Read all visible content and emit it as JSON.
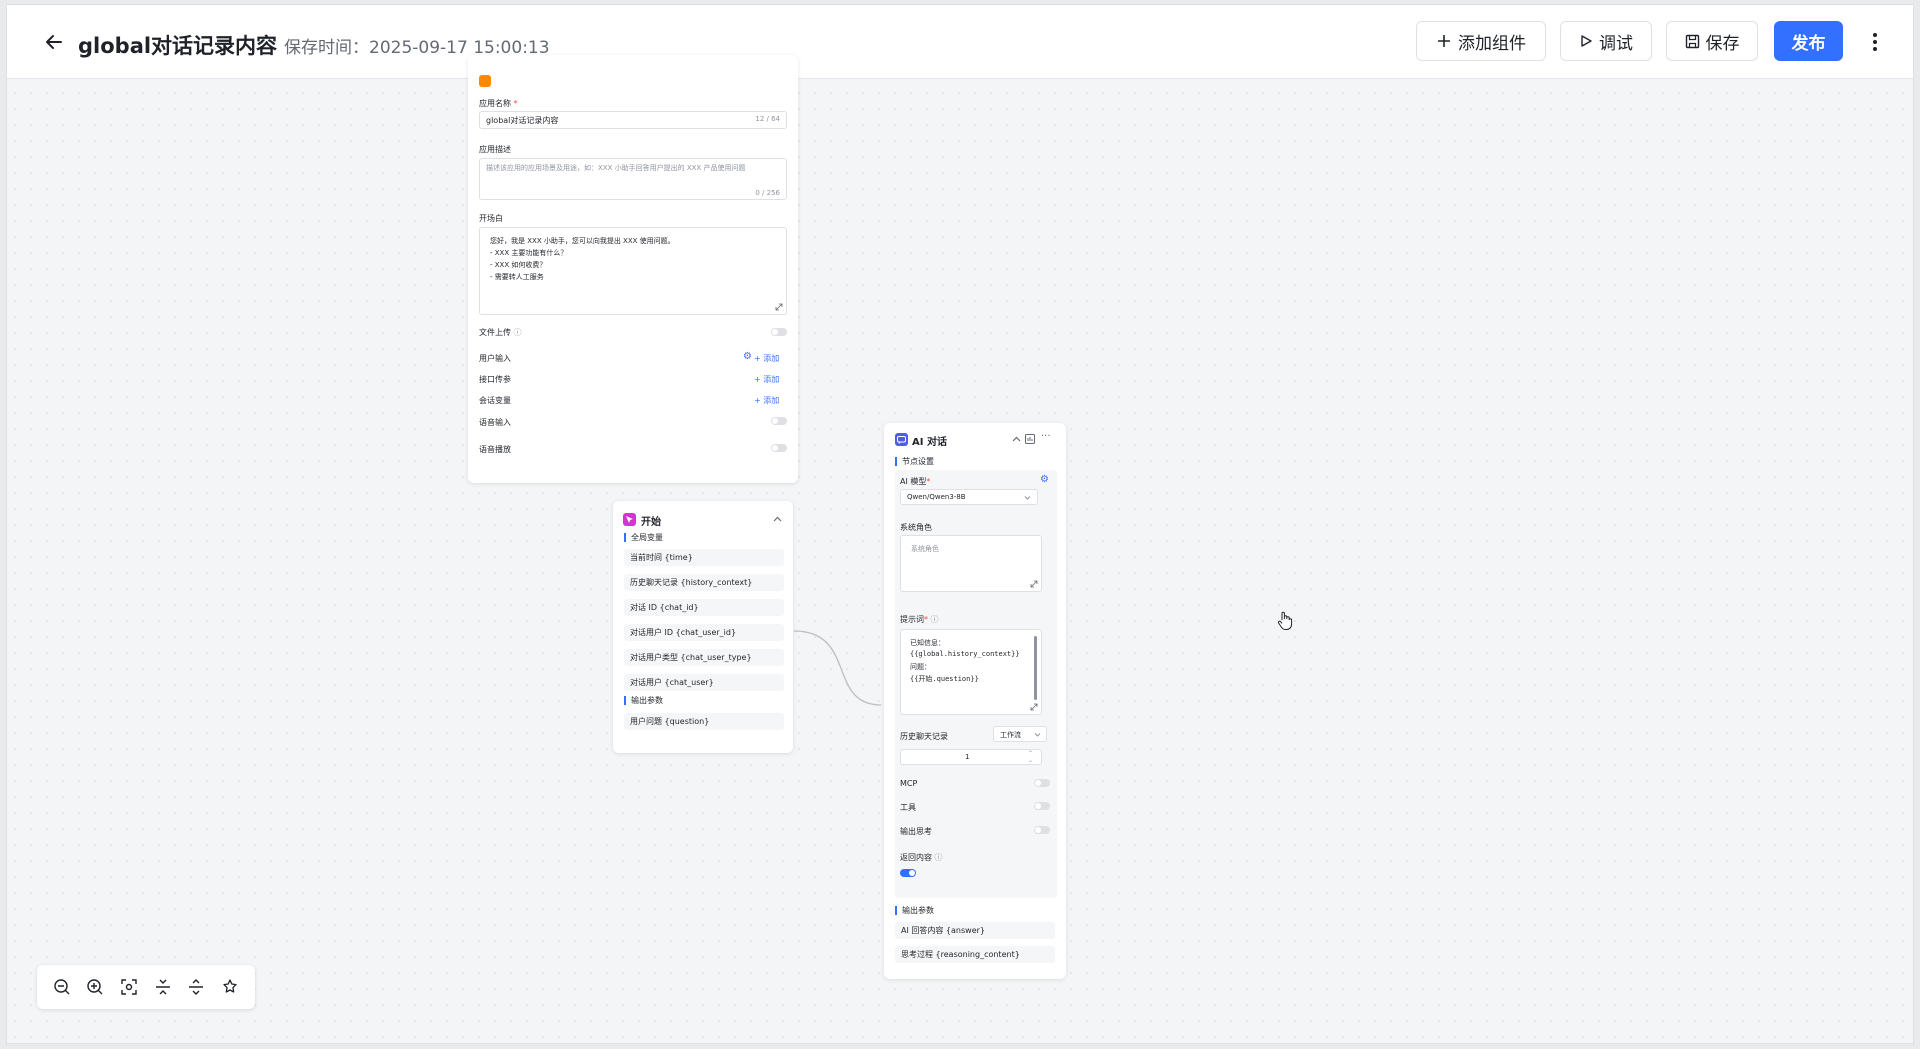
{
  "header": {
    "title": "global对话记录内容",
    "save_time": "保存时间：2025-09-17 15:00:13",
    "add_component": "添加组件",
    "debug": "调试",
    "save": "保存",
    "publish": "发布"
  },
  "base_node": {
    "app_name_label": "应用名称",
    "app_name_value": "global对话记录内容",
    "app_name_count": "12 / 64",
    "app_desc_label": "应用描述",
    "app_desc_placeholder": "描述该应用的应用场景及用途，如：XXX 小助手回答用户提出的 XXX 产品使用问题",
    "app_desc_count": "0 / 256",
    "prologue_label": "开场白",
    "prologue_lines": [
      "您好，我是 XXX 小助手，您可以向我提出 XXX 使用问题。",
      "- XXX 主要功能有什么？",
      "- XXX 如何收费？",
      "- 需要转人工服务"
    ],
    "file_upload": "文件上传",
    "user_input": "用户输入",
    "api_params": "接口传参",
    "session_vars": "会话变量",
    "add": "添加",
    "voice_input": "语音输入",
    "voice_play": "语音播放"
  },
  "start_node": {
    "title": "开始",
    "global_vars_label": "全局变量",
    "global_vars": [
      "当前时间 {time}",
      "历史聊天记录 {history_context}",
      "对话 ID {chat_id}",
      "对话用户 ID {chat_user_id}",
      "对话用户类型 {chat_user_type}",
      "对话用户 {chat_user}"
    ],
    "output_label": "输出参数",
    "outputs": [
      "用户问题 {question}"
    ]
  },
  "ai_node": {
    "title": "AI 对话",
    "node_settings": "节点设置",
    "model_label": "AI 模型",
    "model_value": "Qwen/Qwen3-8B",
    "system_role_label": "系统角色",
    "system_role_placeholder": "系统角色",
    "prompt_label": "提示词",
    "prompt_lines": [
      "已知信息：",
      "{{global.history_context}}",
      "问题：",
      "{{开始.question}}"
    ],
    "history_label": "历史聊天记录",
    "history_mode": "工作流",
    "history_count": "1",
    "mcp": "MCP",
    "tools": "工具",
    "output_thinking": "输出思考",
    "return_content": "返回内容",
    "return_content_on": true,
    "output_label": "输出参数",
    "outputs": [
      "AI 回答内容 {answer}",
      "思考过程 {reasoning_content}"
    ]
  },
  "colors": {
    "primary": "#3370ff",
    "start_icon": "#d136d1",
    "ai_icon": "#4e5ee8",
    "base_icon": "#ff8800"
  }
}
